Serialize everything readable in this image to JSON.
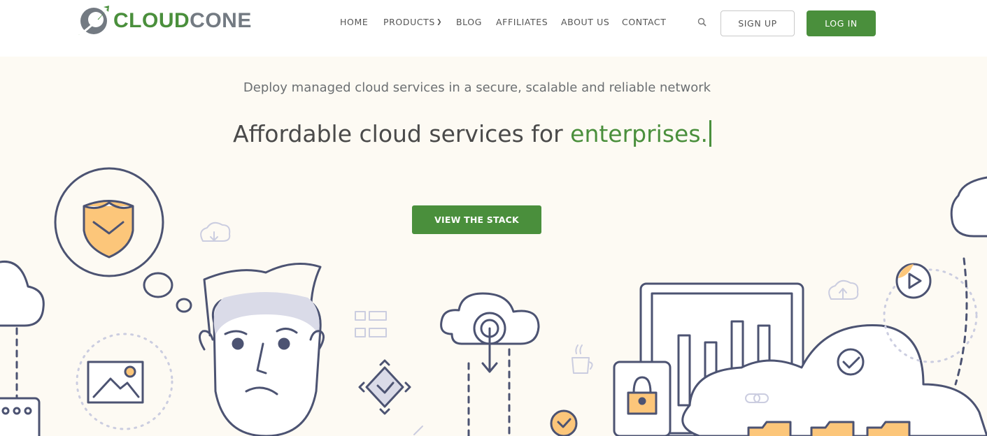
{
  "brand": {
    "name_part1": "CLOUD",
    "name_part2": "CONE",
    "primary_color": "#4a8f3c",
    "secondary_color": "#737a82"
  },
  "nav": {
    "items": [
      {
        "label": "HOME",
        "has_dropdown": false
      },
      {
        "label": "PRODUCTS",
        "has_dropdown": true
      },
      {
        "label": "BLOG",
        "has_dropdown": false
      },
      {
        "label": "AFFILIATES",
        "has_dropdown": false
      },
      {
        "label": "ABOUT US",
        "has_dropdown": false
      },
      {
        "label": "CONTACT",
        "has_dropdown": false
      }
    ],
    "search_icon": "search-icon",
    "signup_label": "SIGN UP",
    "login_label": "LOG IN"
  },
  "hero": {
    "subtitle": "Deploy managed cloud services in a secure, scalable and reliable network",
    "title_prefix": "Affordable cloud services for ",
    "title_accent": "enterprises.",
    "cta_label": "VIEW THE STACK"
  },
  "illustration": {
    "icons": [
      "shield-icon",
      "cloud-download-icon",
      "person-illustration",
      "image-icon",
      "flowchart-icon",
      "cloud-upload-icon",
      "coffee-cup-icon",
      "diamond-check-icon",
      "lock-device-icon",
      "bar-chart-monitor-icon",
      "check-circle-icon",
      "play-icon",
      "link-icon",
      "folder-icon"
    ]
  }
}
